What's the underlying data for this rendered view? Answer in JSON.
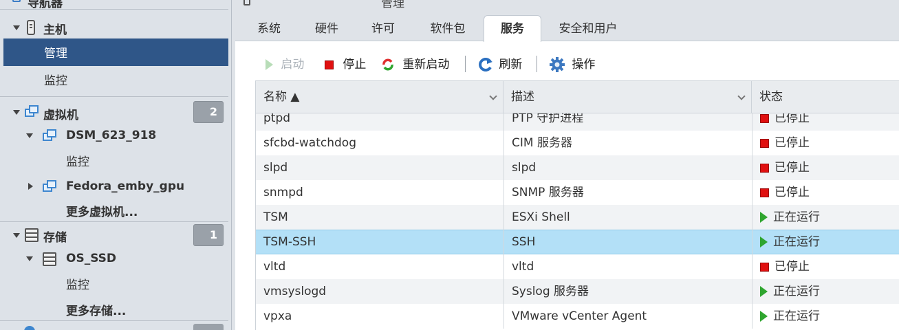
{
  "sidebar": {
    "navigator_label": "导航器",
    "host": {
      "label": "主机",
      "items": [
        "管理",
        "监控"
      ]
    },
    "vms": {
      "label": "虚拟机",
      "count": "2",
      "vm1": {
        "name": "DSM_623_918",
        "child": "监控"
      },
      "vm2": {
        "name": "Fedora_emby_gpu"
      },
      "more": "更多虚拟机..."
    },
    "storage": {
      "label": "存储",
      "count": "1",
      "ds1": {
        "name": "OS_SSD",
        "child": "监控"
      },
      "more": "更多存储..."
    }
  },
  "main": {
    "title": "管理",
    "tabs": [
      "系统",
      "硬件",
      "许可",
      "软件包",
      "服务",
      "安全和用户"
    ],
    "active_tab": "服务",
    "toolbar": {
      "start": "启动",
      "stop": "停止",
      "restart": "重新启动",
      "refresh": "刷新",
      "actions": "操作"
    },
    "columns": {
      "name": "名称 ▲",
      "desc": "描述",
      "status": "状态"
    },
    "rows": [
      {
        "name": "ptpd",
        "desc": "PTP 守护进程",
        "status": "已停止",
        "running": false
      },
      {
        "name": "sfcbd-watchdog",
        "desc": "CIM 服务器",
        "status": "已停止",
        "running": false
      },
      {
        "name": "slpd",
        "desc": "slpd",
        "status": "已停止",
        "running": false
      },
      {
        "name": "snmpd",
        "desc": "SNMP 服务器",
        "status": "已停止",
        "running": false
      },
      {
        "name": "TSM",
        "desc": "ESXi Shell",
        "status": "正在运行",
        "running": true
      },
      {
        "name": "TSM-SSH",
        "desc": "SSH",
        "status": "正在运行",
        "running": true,
        "selected": true
      },
      {
        "name": "vltd",
        "desc": "vltd",
        "status": "已停止",
        "running": false
      },
      {
        "name": "vmsyslogd",
        "desc": "Syslog 服务器",
        "status": "正在运行",
        "running": true
      },
      {
        "name": "vpxa",
        "desc": "VMware vCenter Agent",
        "status": "正在运行",
        "running": true
      }
    ]
  },
  "colors": {
    "selected_nav": "#2f5688",
    "selected_row": "#b3e0f7",
    "running": "#2fa52f",
    "stopped": "#e01010"
  }
}
